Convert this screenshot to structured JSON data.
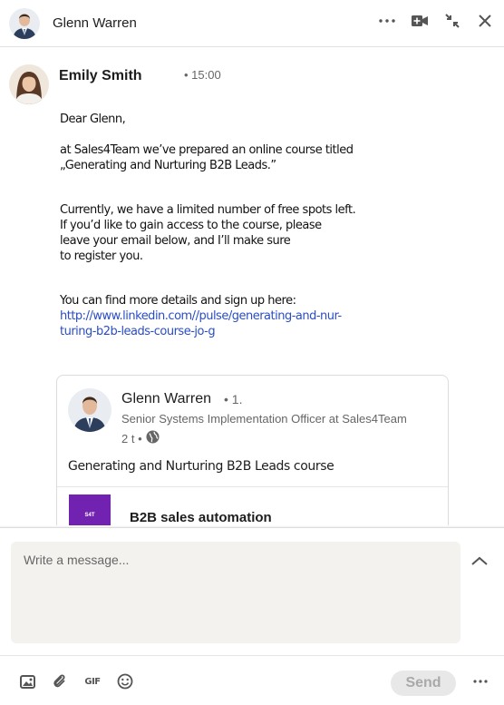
{
  "header": {
    "name": "Glenn Warren",
    "icons": [
      "more-icon",
      "video-call-icon",
      "minimize-icon",
      "close-icon"
    ]
  },
  "message": {
    "sender": "Emily Smith",
    "time": "• 15:00",
    "lines": {
      "greeting": "Dear Glenn,",
      "p1_l1": "at Sales4Team we’ve prepared an online course titled",
      "p1_l2": "„Generating and Nurturing B2B Leads.”",
      "p2_l1": "Currently, we have a limited number of free spots left.",
      "p2_l2": "If you’d like to gain access to the course, please",
      "p2_l3": "leave your email below, and I’ll make sure",
      "p2_l4": "to register you.",
      "p3_l1": "You can find more details and sign up here:"
    },
    "link_l1": "http://www.linkedin.com//pulse/generating-and-nur-",
    "link_l2": "turing-b2b-leads-course-jo-g"
  },
  "shared_post": {
    "author": "Glenn Warren",
    "degree": "• 1.",
    "headline": "Senior Systems Implementation Officer at Sales4Team",
    "age": "2 t •",
    "text": "Generating and Nurturing B2B Leads course",
    "thumb_label": "S4T",
    "article_title": "B2B sales automation"
  },
  "composer": {
    "placeholder": "Write a message...",
    "send_label": "Send",
    "gif_label": "GIF"
  },
  "colors": {
    "link": "#2a4dc6",
    "thumb": "#7222b0",
    "input_bg": "#f3f2ef"
  }
}
